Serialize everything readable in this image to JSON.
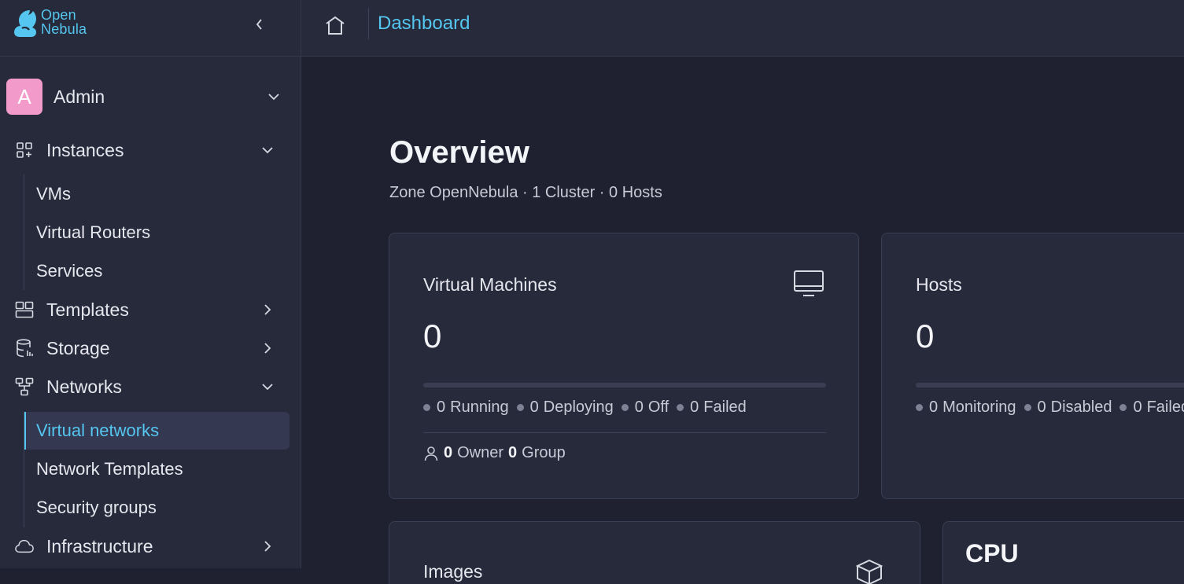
{
  "brand": {
    "line1": "Open",
    "line2": "Nebula",
    "color": "#54c6ef"
  },
  "user": {
    "initial": "A",
    "name": "Admin",
    "avatar_color": "#f29ac9"
  },
  "sidebar": {
    "items": [
      {
        "label": "Instances",
        "icon": "apps-add-icon",
        "expanded": true,
        "children": [
          "VMs",
          "Virtual Routers",
          "Services"
        ]
      },
      {
        "label": "Templates",
        "icon": "templates-icon",
        "expanded": false
      },
      {
        "label": "Storage",
        "icon": "database-icon",
        "expanded": false
      },
      {
        "label": "Networks",
        "icon": "network-icon",
        "expanded": true,
        "children": [
          "Virtual networks",
          "Network Templates",
          "Security groups"
        ],
        "active_child": "Virtual networks"
      },
      {
        "label": "Infrastructure",
        "icon": "cloud-icon",
        "expanded": false
      }
    ]
  },
  "topbar": {
    "breadcrumb": "Dashboard"
  },
  "main": {
    "title": "Overview",
    "subtitle": "Zone OpenNebula · 1 Cluster · 0 Hosts",
    "cards": {
      "vms": {
        "title": "Virtual Machines",
        "count": "0",
        "icon": "monitor-icon",
        "stats": [
          {
            "value": "0",
            "label": "Running"
          },
          {
            "value": "0",
            "label": "Deploying"
          },
          {
            "value": "0",
            "label": "Off"
          },
          {
            "value": "0",
            "label": "Failed"
          }
        ],
        "owner": {
          "owner_count": "0",
          "owner_label": "Owner",
          "group_count": "0",
          "group_label": "Group"
        }
      },
      "hosts": {
        "title": "Hosts",
        "count": "0",
        "stats": [
          {
            "value": "0",
            "label": "Monitoring"
          },
          {
            "value": "0",
            "label": "Disabled"
          },
          {
            "value": "0",
            "label": "Failed"
          }
        ]
      },
      "images": {
        "title": "Images",
        "icon": "box-icon"
      },
      "cpu": {
        "title": "CPU"
      }
    }
  },
  "colors": {
    "accent": "#54c6ef",
    "bg": "#1f2130",
    "panel": "#272a3b"
  }
}
